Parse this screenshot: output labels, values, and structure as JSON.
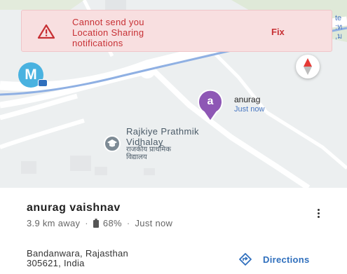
{
  "alert": {
    "message": "Cannot send you\nLocation Sharing\nnotifications",
    "action_label": "Fix"
  },
  "map": {
    "right_edge_text": "te\n:ท\n,ม",
    "my_avatar_letter": "M",
    "friend_pin": {
      "letter": "a",
      "name": "anurag",
      "time": "Just now"
    },
    "place": {
      "name": "Rajkiye Prathmik\nVidhalay",
      "local_name": "राजकीय प्राथमिक\nविद्यालय"
    }
  },
  "sheet": {
    "person_name": "anurag vaishnav",
    "distance": "3.9 km away",
    "battery": "68%",
    "updated": "Just now",
    "address": "Bandanwara, Rajasthan\n305621, India",
    "directions_label": "Directions"
  },
  "colors": {
    "alert_bg": "#f8dfe0",
    "alert_text": "#c73034",
    "accent_blue": "#2f6fbd",
    "pin_purple": "#8e57b5",
    "avatar_blue": "#49b2e0"
  }
}
